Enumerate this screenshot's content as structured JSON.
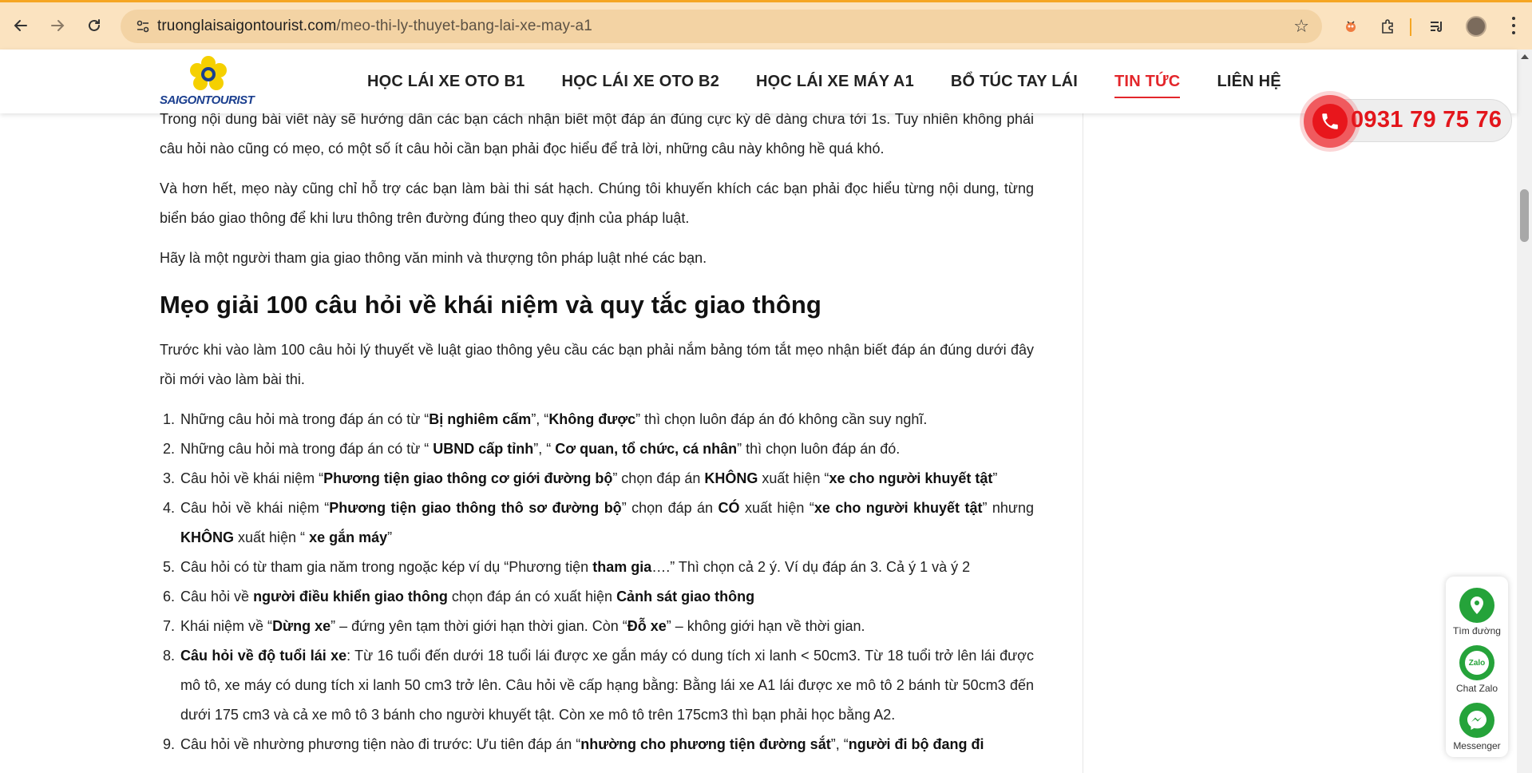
{
  "browser": {
    "url_domain": "truonglaisaigontourist.com",
    "url_path": "/meo-thi-ly-thuyet-bang-lai-xe-may-a1"
  },
  "site": {
    "brand": "SAIGONTOURIST",
    "nav": [
      {
        "label": "HỌC LÁI XE OTO B1",
        "active": false
      },
      {
        "label": "HỌC LÁI XE OTO B2",
        "active": false
      },
      {
        "label": "HỌC LÁI XE MÁY A1",
        "active": false
      },
      {
        "label": "BỔ TÚC TAY LÁI",
        "active": false
      },
      {
        "label": "TIN TỨC",
        "active": true
      },
      {
        "label": "LIÊN HỆ",
        "active": false
      }
    ],
    "hotline": "0931 79 75 76"
  },
  "article": {
    "p1": "Trong nội dung bài viết này sẽ hướng dẫn các bạn cách nhận biết một đáp án đúng cực kỳ dễ dàng chưa tới 1s. Tuy nhiên không phải câu hỏi nào cũng có mẹo, có một số ít câu hỏi cần bạn phải đọc hiểu để trả lời, những câu này không hề quá khó.",
    "p2": "Và hơn hết, mẹo này cũng chỉ hỗ trợ các bạn làm bài thi sát hạch. Chúng tôi khuyến khích các bạn phải đọc hiểu từng nội dung, từng biển báo giao thông để khi lưu thông trên đường đúng theo quy định của pháp luật.",
    "p3": "Hãy là một người tham gia giao thông văn minh và thượng tôn pháp luật nhé các bạn.",
    "heading": "Mẹo giải 100 câu hỏi về khái niệm và quy tắc giao thông",
    "p4": "Trước khi vào làm 100 câu hỏi lý thuyết về luật giao thông yêu cầu các bạn phải nắm bảng tóm tắt mẹo nhận biết đáp án đúng dưới đây rồi mới vào làm bài thi.",
    "list": [
      [
        {
          "t": "Những câu hỏi mà trong đáp án có từ “"
        },
        {
          "t": "Bị nghiêm cấm",
          "b": true
        },
        {
          "t": "”, “"
        },
        {
          "t": "Không được",
          "b": true
        },
        {
          "t": "” thì chọn luôn đáp án đó không cần suy nghĩ."
        }
      ],
      [
        {
          "t": "Những câu hỏi mà trong đáp án có từ “ "
        },
        {
          "t": "UBND cấp tỉnh",
          "b": true
        },
        {
          "t": "”, “ "
        },
        {
          "t": "Cơ quan, tổ chức, cá nhân",
          "b": true
        },
        {
          "t": "” thì chọn luôn đáp án đó."
        }
      ],
      [
        {
          "t": "Câu hỏi về khái niệm “"
        },
        {
          "t": "Phương tiện giao thông cơ giới đường bộ",
          "b": true
        },
        {
          "t": "” chọn đáp án "
        },
        {
          "t": "KHÔNG",
          "b": true
        },
        {
          "t": " xuất hiện “"
        },
        {
          "t": "xe cho người khuyết tật",
          "b": true
        },
        {
          "t": "”"
        }
      ],
      [
        {
          "t": "Câu hỏi về khái niệm “"
        },
        {
          "t": "Phương tiện giao thông thô sơ đường bộ",
          "b": true
        },
        {
          "t": "” chọn đáp án "
        },
        {
          "t": "CÓ",
          "b": true
        },
        {
          "t": " xuất hiện “"
        },
        {
          "t": "xe cho người khuyết tật",
          "b": true
        },
        {
          "t": "” nhưng "
        },
        {
          "t": "KHÔNG",
          "b": true
        },
        {
          "t": " xuất hiện “ "
        },
        {
          "t": "xe gắn máy",
          "b": true
        },
        {
          "t": "”"
        }
      ],
      [
        {
          "t": "Câu hỏi có từ tham gia năm trong ngoặc kép ví dụ “Phương tiện "
        },
        {
          "t": "tham gia",
          "b": true
        },
        {
          "t": "….” Thì chọn cả 2 ý. Ví dụ đáp án 3. Cả ý 1 và ý 2"
        }
      ],
      [
        {
          "t": "Câu hỏi về "
        },
        {
          "t": "người điều khiển giao thông",
          "b": true
        },
        {
          "t": " chọn đáp án có xuất hiện "
        },
        {
          "t": "Cảnh sát giao thông",
          "b": true
        }
      ],
      [
        {
          "t": "Khái niệm về “"
        },
        {
          "t": "Dừng xe",
          "b": true
        },
        {
          "t": "” – đứng yên tạm thời giới hạn thời gian. Còn “"
        },
        {
          "t": "Đỗ xe",
          "b": true
        },
        {
          "t": "” – không giới hạn về thời gian."
        }
      ],
      [
        {
          "t": "Câu hỏi về độ tuổi lái xe",
          "b": true
        },
        {
          "t": ": Từ 16 tuổi đến dưới 18 tuổi lái được xe gắn máy có dung tích xi lanh < 50cm3. Từ 18 tuổi trở lên lái được mô tô, xe máy có dung tích xi lanh 50 cm3 trở lên. Câu hỏi về cấp hạng bằng: Bằng lái xe A1 lái được xe mô tô 2 bánh từ 50cm3 đến dưới 175 cm3 và cả xe mô tô 3 bánh cho người khuyết tật. Còn xe mô tô trên 175cm3 thì bạn phải học bằng A2."
        }
      ],
      [
        {
          "t": "Câu hỏi về nhường phương tiện nào đi trước: Ưu tiên đáp án “"
        },
        {
          "t": "nhường cho phương tiện đường sắt",
          "b": true
        },
        {
          "t": "”, “"
        },
        {
          "t": "người đi bộ đang đi",
          "b": true
        }
      ]
    ]
  },
  "float_widget": {
    "items": [
      {
        "label": "Tìm đường",
        "icon": "map-pin-icon"
      },
      {
        "label": "Chat Zalo",
        "icon": "zalo-icon"
      },
      {
        "label": "Messenger",
        "icon": "messenger-icon"
      }
    ],
    "accent": "#25a33a"
  },
  "colors": {
    "accent_red": "#e3262b",
    "chrome_bg": "#fbe3c0"
  }
}
